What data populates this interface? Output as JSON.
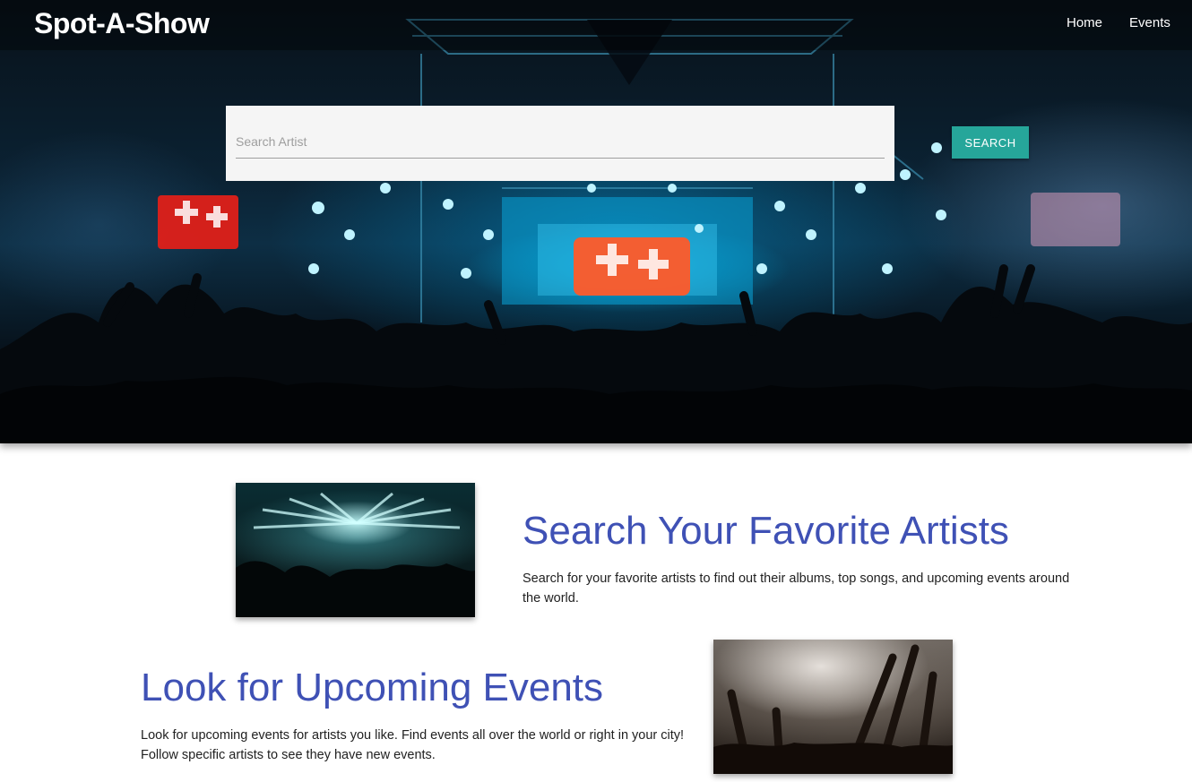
{
  "navbar": {
    "brand": "Spot-A-Show",
    "links": [
      "Home",
      "Events"
    ]
  },
  "search": {
    "placeholder": "Search Artist",
    "value": "",
    "button_label": "SEARCH"
  },
  "features": [
    {
      "title": "Search Your Favorite Artists",
      "text": "Search for your favorite artists to find out their albums, top songs, and upcoming events around the world."
    },
    {
      "title": "Look for Upcoming Events",
      "text": "Look for upcoming events for artists you like. Find events all over the world or right in your city! Follow specific artists to see they have new events."
    }
  ],
  "colors": {
    "accent_button": "#26a69a",
    "heading": "#3f51b5"
  }
}
